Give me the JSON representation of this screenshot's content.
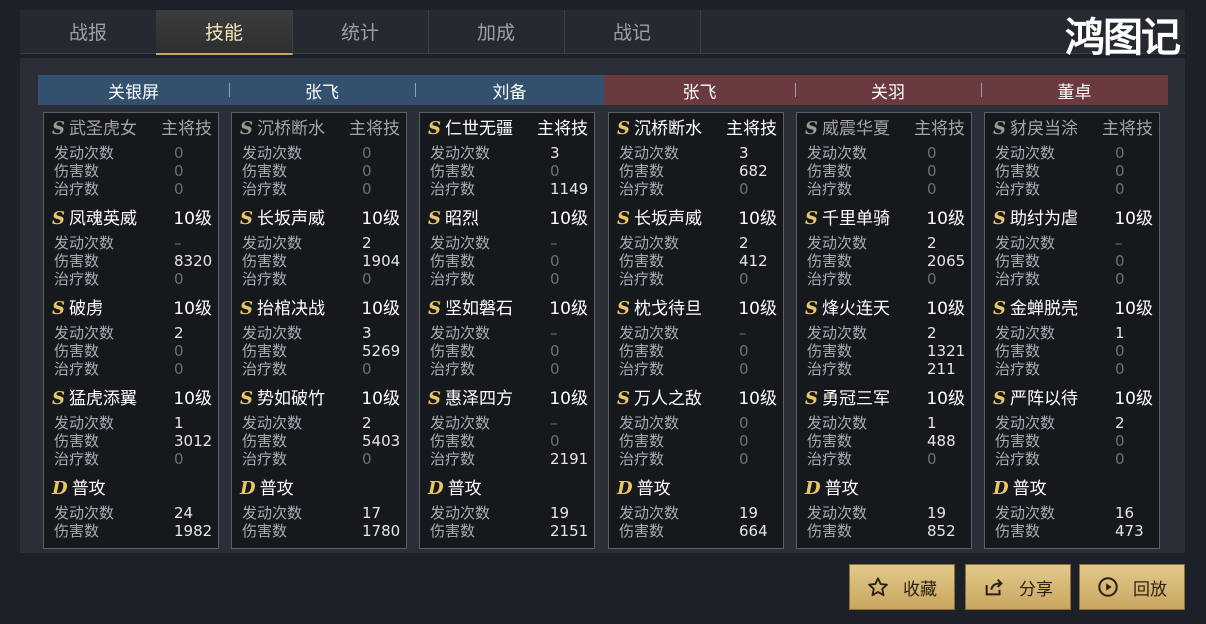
{
  "tabs": [
    "战报",
    "技能",
    "统计",
    "加成",
    "战记"
  ],
  "logo": "鸿图记",
  "stat_labels": {
    "trigger": "发动次数",
    "damage": "伤害数",
    "heal": "治疗数"
  },
  "columns": [
    {
      "name": "关银屏",
      "side": "blue",
      "skills": [
        {
          "grade": "S",
          "name": "武圣虎女",
          "level": "主将技",
          "dim": true,
          "trigger": "0",
          "damage": "0",
          "heal": "0"
        },
        {
          "grade": "S",
          "name": "凤魂英威",
          "level": "10级",
          "trigger": "–",
          "damage": "8320",
          "heal": "0"
        },
        {
          "grade": "S",
          "name": "破虏",
          "level": "10级",
          "trigger": "2",
          "damage": "0",
          "heal": "0"
        },
        {
          "grade": "S",
          "name": "猛虎添翼",
          "level": "10级",
          "trigger": "1",
          "damage": "3012",
          "heal": "0"
        },
        {
          "grade": "D",
          "name": "普攻",
          "level": "",
          "trigger": "24",
          "damage": "1982"
        }
      ]
    },
    {
      "name": "张飞",
      "side": "blue",
      "skills": [
        {
          "grade": "S",
          "name": "沉桥断水",
          "level": "主将技",
          "dim": true,
          "trigger": "0",
          "damage": "0",
          "heal": "0"
        },
        {
          "grade": "S",
          "name": "长坂声威",
          "level": "10级",
          "trigger": "2",
          "damage": "1904",
          "heal": "0"
        },
        {
          "grade": "S",
          "name": "抬棺决战",
          "level": "10级",
          "trigger": "3",
          "damage": "5269",
          "heal": "0"
        },
        {
          "grade": "S",
          "name": "势如破竹",
          "level": "10级",
          "trigger": "2",
          "damage": "5403",
          "heal": "0"
        },
        {
          "grade": "D",
          "name": "普攻",
          "level": "",
          "trigger": "17",
          "damage": "1780"
        }
      ]
    },
    {
      "name": "刘备",
      "side": "blue",
      "skills": [
        {
          "grade": "S",
          "name": "仁世无疆",
          "level": "主将技",
          "trigger": "3",
          "damage": "0",
          "heal": "1149"
        },
        {
          "grade": "S",
          "name": "昭烈",
          "level": "10级",
          "trigger": "–",
          "damage": "0",
          "heal": "0"
        },
        {
          "grade": "S",
          "name": "坚如磐石",
          "level": "10级",
          "trigger": "–",
          "damage": "0",
          "heal": "0"
        },
        {
          "grade": "S",
          "name": "惠泽四方",
          "level": "10级",
          "trigger": "–",
          "damage": "0",
          "heal": "2191"
        },
        {
          "grade": "D",
          "name": "普攻",
          "level": "",
          "trigger": "19",
          "damage": "2151"
        }
      ]
    },
    {
      "name": "张飞",
      "side": "red",
      "skills": [
        {
          "grade": "S",
          "name": "沉桥断水",
          "level": "主将技",
          "trigger": "3",
          "damage": "682",
          "heal": "0"
        },
        {
          "grade": "S",
          "name": "长坂声威",
          "level": "10级",
          "trigger": "2",
          "damage": "412",
          "heal": "0"
        },
        {
          "grade": "S",
          "name": "枕戈待旦",
          "level": "10级",
          "trigger": "–",
          "damage": "0",
          "heal": "0"
        },
        {
          "grade": "S",
          "name": "万人之敌",
          "level": "10级",
          "trigger": "0",
          "damage": "0",
          "heal": "0"
        },
        {
          "grade": "D",
          "name": "普攻",
          "level": "",
          "trigger": "19",
          "damage": "664"
        }
      ]
    },
    {
      "name": "关羽",
      "side": "red",
      "skills": [
        {
          "grade": "S",
          "name": "威震华夏",
          "level": "主将技",
          "dim": true,
          "trigger": "0",
          "damage": "0",
          "heal": "0"
        },
        {
          "grade": "S",
          "name": "千里单骑",
          "level": "10级",
          "trigger": "2",
          "damage": "2065",
          "heal": "0"
        },
        {
          "grade": "S",
          "name": "烽火连天",
          "level": "10级",
          "trigger": "2",
          "damage": "1321",
          "heal": "211"
        },
        {
          "grade": "S",
          "name": "勇冠三军",
          "level": "10级",
          "trigger": "1",
          "damage": "488",
          "heal": "0"
        },
        {
          "grade": "D",
          "name": "普攻",
          "level": "",
          "trigger": "19",
          "damage": "852"
        }
      ]
    },
    {
      "name": "董卓",
      "side": "red",
      "skills": [
        {
          "grade": "S",
          "name": "豺戾当涂",
          "level": "主将技",
          "dim": true,
          "trigger": "0",
          "damage": "0",
          "heal": "0"
        },
        {
          "grade": "S",
          "name": "助纣为虐",
          "level": "10级",
          "trigger": "–",
          "damage": "0",
          "heal": "0"
        },
        {
          "grade": "S",
          "name": "金蝉脱壳",
          "level": "10级",
          "trigger": "1",
          "damage": "0",
          "heal": "0"
        },
        {
          "grade": "S",
          "name": "严阵以待",
          "level": "10级",
          "trigger": "2",
          "damage": "0",
          "heal": "0"
        },
        {
          "grade": "D",
          "name": "普攻",
          "level": "",
          "trigger": "16",
          "damage": "473"
        }
      ]
    }
  ],
  "buttons": {
    "collect": "收藏",
    "share": "分享",
    "replay": "回放"
  }
}
